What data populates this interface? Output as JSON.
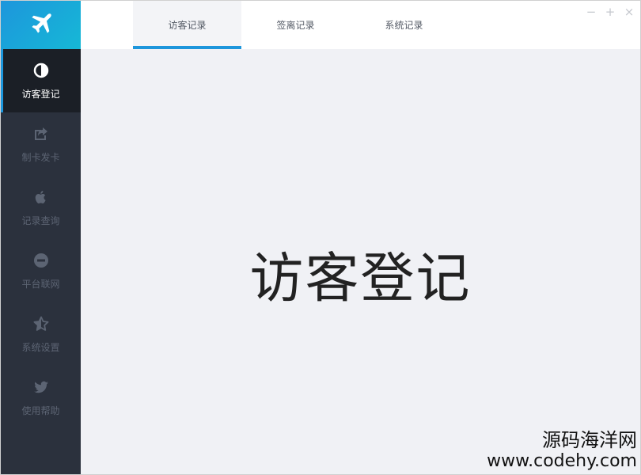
{
  "sidebar": {
    "logo_icon": "airplane-icon",
    "accent_color": "#1d96dc",
    "items": [
      {
        "label": "访客登记",
        "icon": "half-circle-icon",
        "active": true
      },
      {
        "label": "制卡发卡",
        "icon": "share-icon",
        "active": false
      },
      {
        "label": "记录查询",
        "icon": "apple-icon",
        "active": false
      },
      {
        "label": "平台联网",
        "icon": "minus-circle-icon",
        "active": false
      },
      {
        "label": "系统设置",
        "icon": "star-icon",
        "active": false
      },
      {
        "label": "使用帮助",
        "icon": "twitter-bird-icon",
        "active": false
      }
    ]
  },
  "tabs": [
    {
      "label": "访客记录",
      "active": true
    },
    {
      "label": "签离记录",
      "active": false
    },
    {
      "label": "系统记录",
      "active": false
    }
  ],
  "window_controls": {
    "minimize": "−",
    "maximize": "+",
    "close": "×"
  },
  "main": {
    "title": "访客登记"
  },
  "watermark": {
    "line1": "源码海洋网",
    "line2": "www.codehy.com"
  }
}
